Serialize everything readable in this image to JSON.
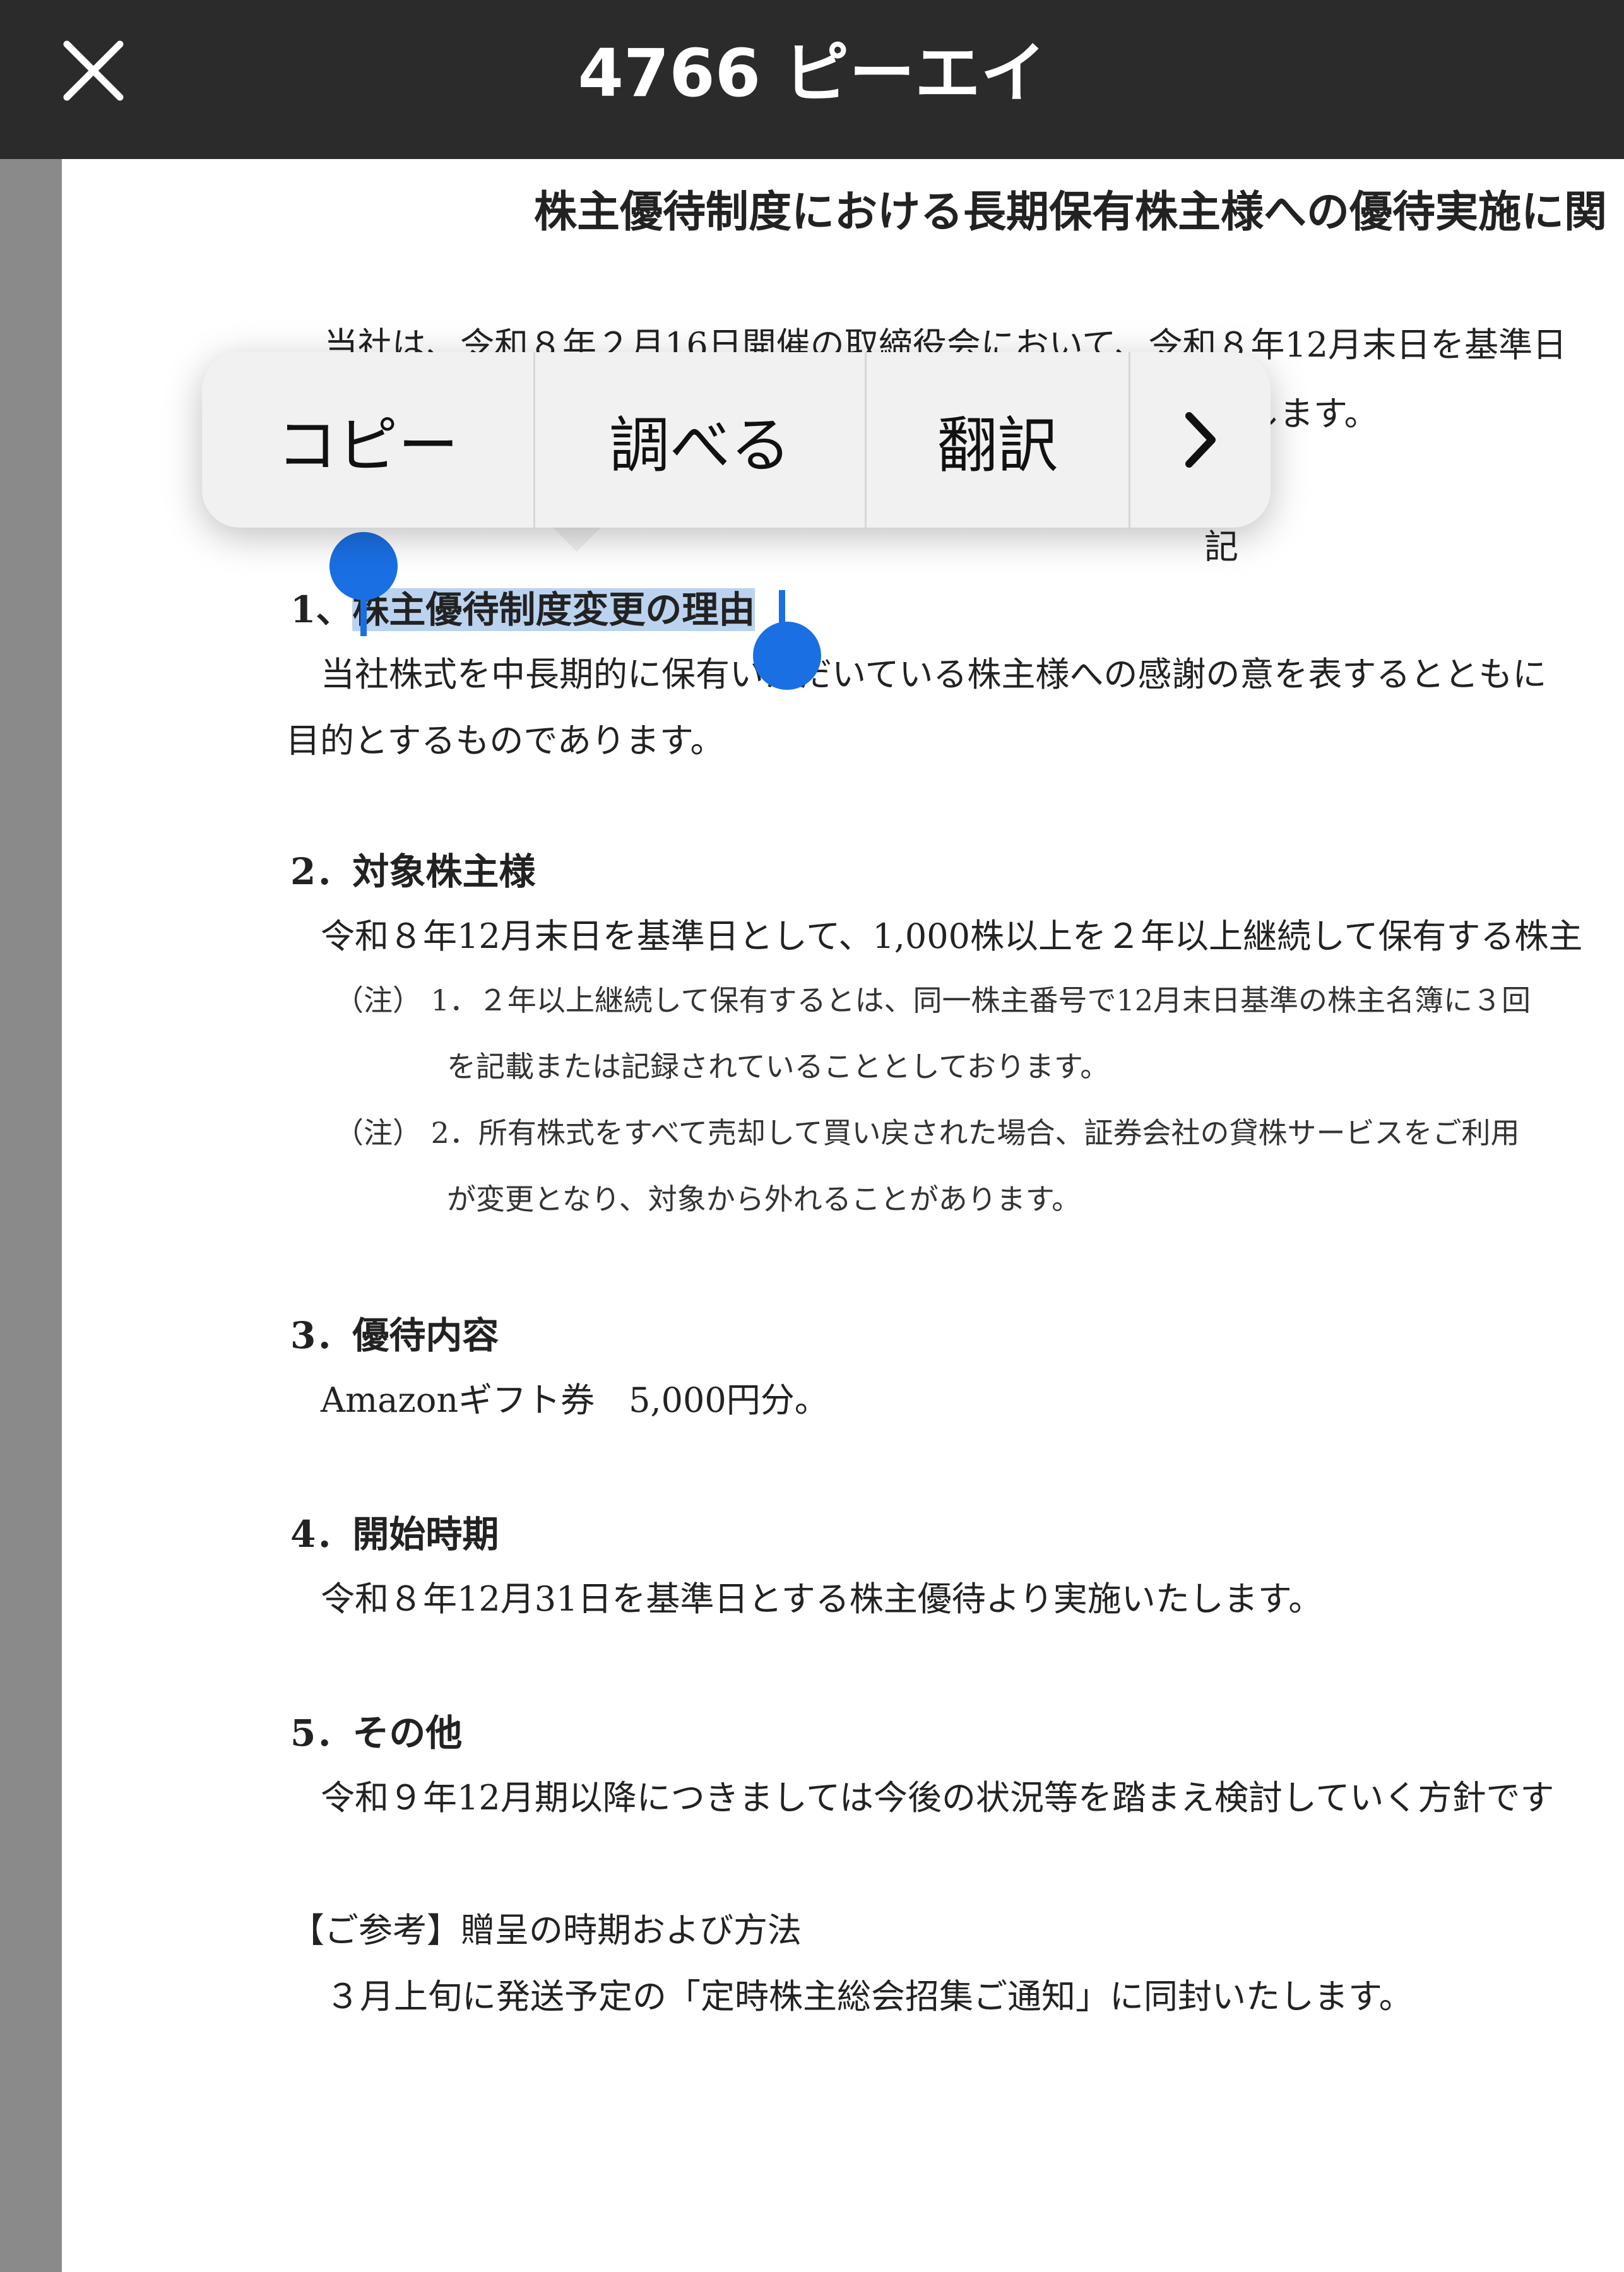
{
  "header": {
    "title": "4766 ピーエイ",
    "close_icon": "close-icon"
  },
  "document": {
    "title": "株主優待制度における長期保有株主様への優待実施に関",
    "intro_line1": "当社は、令和８年２月16日開催の取締役会において、令和８年12月末日を基準日",
    "intro_line2": "します。",
    "ki": "記",
    "section1": {
      "heading_prefix": "1、",
      "heading_selected": "株主優待制度変更の理由",
      "body_line1": "当社株式を中長期的に保有いただいている株主様への感謝の意を表するとともに",
      "body_line2": "目的とするものであります。"
    },
    "section2": {
      "heading": "2．対象株主様",
      "body": "令和８年12月末日を基準日として、1,000株以上を２年以上継続して保有する株主",
      "note1_line1": "（注） 1．２年以上継続して保有するとは、同一株主番号で12月末日基準の株主名簿に３回",
      "note1_line2": "を記載または記録されていることとしております。",
      "note2_line1": "（注） 2．所有株式をすべて売却して買い戻された場合、証券会社の貸株サービスをご利用",
      "note2_line2": "が変更となり、対象から外れることがあります。"
    },
    "section3": {
      "heading": "3．優待内容",
      "body": "Amazonギフト券　5,000円分。"
    },
    "section4": {
      "heading": "4．開始時期",
      "body": "令和８年12月31日を基準日とする株主優待より実施いたします。"
    },
    "section5": {
      "heading": "5．その他",
      "body": "令和９年12月期以降につきましては今後の状況等を踏まえ検討していく方針です"
    },
    "footer": {
      "heading": "【ご参考】贈呈の時期および方法",
      "body": "３月上旬に発送予定の「定時株主総会招集ご通知」に同封いたします。"
    }
  },
  "context_menu": {
    "copy": "コピー",
    "lookup": "調べる",
    "translate": "翻訳",
    "more_icon": "chevron-right-icon"
  },
  "colors": {
    "topbar": "#2b2b2b",
    "selection": "#bcd3ef",
    "handle": "#1a6fe3",
    "menu_bg": "#f1f1f1"
  }
}
